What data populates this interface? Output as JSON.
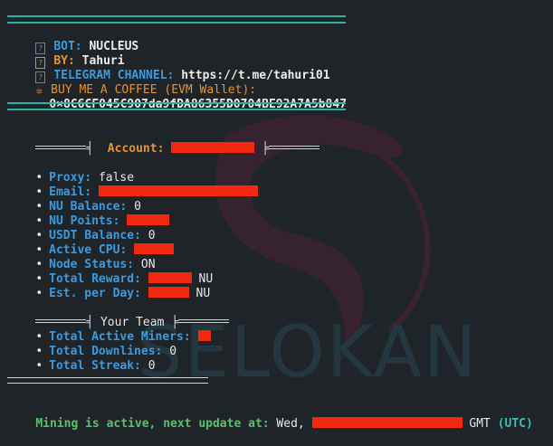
{
  "header": {
    "bot_label": "BOT:",
    "bot_value": "NUCLEUS",
    "by_label": "BY:",
    "by_value": "Tahuri",
    "telegram_label": "TELEGRAM CHANNEL:",
    "telegram_value": "https://t.me/tahuri01",
    "coffee_label": "BUY ME A COFFEE (EVM Wallet):",
    "wallet": "0×8C6CF045C907da9fDA86355D0704BE92A7A5b847"
  },
  "account": {
    "label": "Account:"
  },
  "stats": {
    "proxy_label": "Proxy:",
    "proxy_value": "false",
    "email_label": "Email:",
    "nu_balance_label": "NU Balance:",
    "nu_balance_value": "0",
    "nu_points_label": "NU Points:",
    "usdt_balance_label": "USDT Balance:",
    "usdt_balance_value": "0",
    "active_cpu_label": "Active CPU:",
    "node_status_label": "Node Status:",
    "node_status_value": "ON",
    "total_reward_label": "Total Reward:",
    "total_reward_unit": "NU",
    "est_day_label": "Est. per Day:",
    "est_day_unit": "NU",
    "bullet": "•"
  },
  "team": {
    "title": "Your Team",
    "active_miners_label": "Total Active Miners:",
    "downlines_label": "Total Downlines:",
    "downlines_value": "0",
    "streak_label": "Total Streak:",
    "streak_value": "0"
  },
  "footer": {
    "status_text": "Mining is active, next update at:",
    "day": "Wed,",
    "tz": "GMT",
    "utc": "(UTC)"
  },
  "watermark": "SELOKAN",
  "colors": {
    "background": "#1f2428",
    "label_blue": "#3a9be0",
    "accent_orange": "#e5922f",
    "rule_cyan": "#2bb3a5",
    "redaction_red": "#f0290f",
    "status_green": "#58c26a"
  },
  "icons": [
    "info-box-icon",
    "coffee-icon"
  ]
}
